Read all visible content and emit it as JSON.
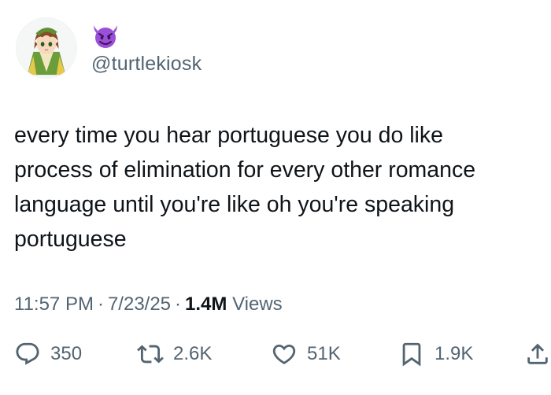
{
  "author": {
    "handle": "@turtlekiosk",
    "avatar_icon": "anime-character-avatar",
    "name_emoji_icon": "smiling-imp-emoji"
  },
  "tweet": {
    "text": "every time you hear portuguese you do like\nprocess of elimination for every other romance\nlanguage until you're like oh you're speaking\nportuguese"
  },
  "meta": {
    "time": "11:57 PM",
    "date": "7/23/25",
    "views_count": "1.4M",
    "views_label": "Views"
  },
  "actions": {
    "replies": "350",
    "reposts": "2.6K",
    "likes": "51K",
    "bookmarks": "1.9K"
  },
  "colors": {
    "text": "#0f1419",
    "secondary": "#536471",
    "emoji_purple": "#9b4fd9"
  }
}
